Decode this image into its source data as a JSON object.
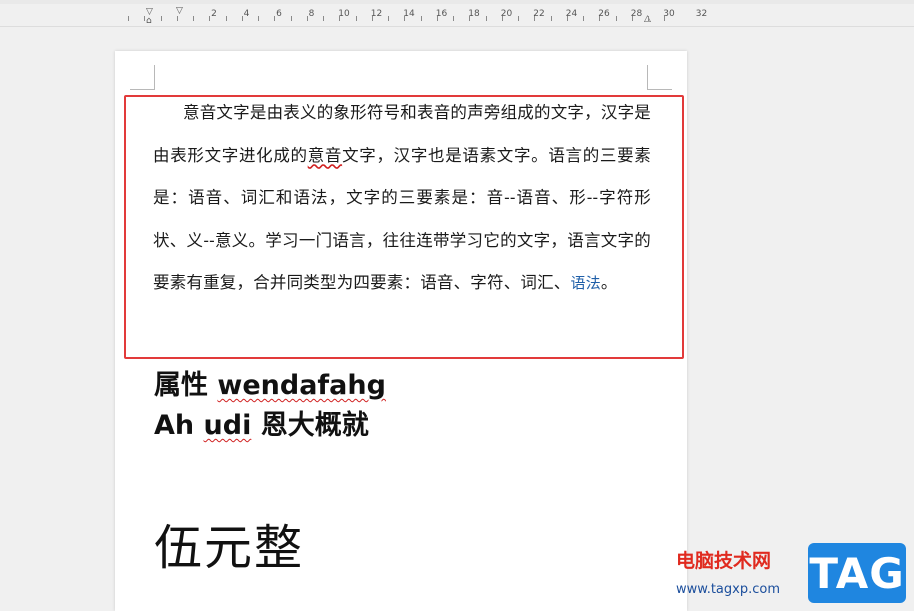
{
  "ruler": {
    "numbers": [
      "2",
      "4",
      "6",
      "8",
      "10",
      "12",
      "14",
      "16",
      "18",
      "20",
      "22",
      "24",
      "26",
      "28",
      "30",
      "32"
    ]
  },
  "document": {
    "paragraph": {
      "part1": "意音文字是由表义的象形符号和表音的声旁组成的文字，汉字是由表形文字进化成的",
      "underlined": "意音",
      "part2": "文字，汉字也是语素文字。语言的三要素是：语音、词汇和语法，文字的三要素是：音--语音、形--字符形状、义--意义。学习一门语言，往往连带学习它的文字，语言文字的要素有重复，合并同类型为四要素：语音、字符、词汇、",
      "blue_word": "语法",
      "end": "。"
    },
    "line1_prefix": "属性 ",
    "line1_word": "wendafahg",
    "line2_prefix": "Ah ",
    "line2_word": "udi",
    "line2_suffix": " 恩大概就",
    "big_text": "伍元整"
  },
  "watermark": {
    "site_name": "电脑技术网",
    "url": "www.tagxp.com",
    "badge": "TAG"
  },
  "colors": {
    "highlight_border": "#e23a3a",
    "spell_underline": "#d02020",
    "watermark_red": "#e02a1f",
    "watermark_blue": "#1f86e0"
  }
}
